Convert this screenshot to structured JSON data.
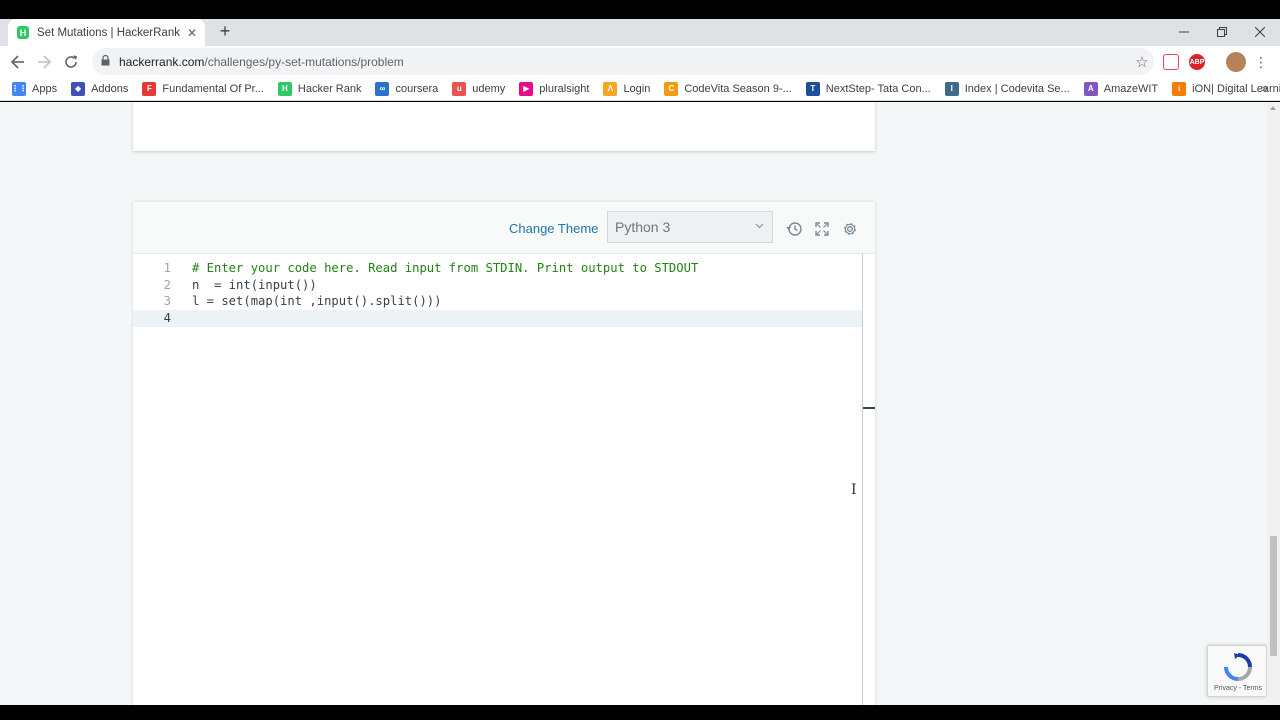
{
  "browser": {
    "tab": {
      "title": "Set Mutations | HackerRank",
      "favicon_letter": "H"
    },
    "url": {
      "host": "hackerrank.com",
      "path": "/challenges/py-set-mutations/problem"
    },
    "extensions": [
      {
        "name": "pocket-extension",
        "label": ""
      },
      {
        "name": "adblock-extension",
        "label": "ABP"
      }
    ]
  },
  "bookmarks": [
    {
      "icon": "apps-grid-icon",
      "label": "Apps",
      "color": "#4285f4"
    },
    {
      "icon": "addons-icon",
      "label": "Addons",
      "color": "#3f51b5"
    },
    {
      "icon": "fundamental-icon",
      "label": "Fundamental Of Pr...",
      "color": "#e53935"
    },
    {
      "icon": "hackerrank-icon",
      "label": "Hacker Rank",
      "color": "#2ec866"
    },
    {
      "icon": "coursera-icon",
      "label": "coursera",
      "color": "#2a73cc"
    },
    {
      "icon": "udemy-icon",
      "label": "udemy",
      "color": "#ec5252"
    },
    {
      "icon": "pluralsight-icon",
      "label": "pluralsight",
      "color": "#e80a89"
    },
    {
      "icon": "login-icon",
      "label": "Login",
      "color": "#f5a623"
    },
    {
      "icon": "codevita-icon",
      "label": "CodeVita Season 9-...",
      "color": "#f39c12"
    },
    {
      "icon": "tata-icon",
      "label": "NextStep- Tata Con...",
      "color": "#1f4e99"
    },
    {
      "icon": "index-icon",
      "label": "Index | Codevita Se...",
      "color": "#3f6b8a"
    },
    {
      "icon": "amazewit-icon",
      "label": "AmazeWIT",
      "color": "#7e57c2"
    },
    {
      "icon": "ion-icon",
      "label": "iON| Digital Learning",
      "color": "#f57c00"
    }
  ],
  "editor": {
    "change_theme_label": "Change Theme",
    "language": "Python 3",
    "lines": [
      {
        "num": "1",
        "text": "# Enter your code here. Read input from STDIN. Print output to STDOUT",
        "kind": "comment"
      },
      {
        "num": "2",
        "text": "n  = int(input())",
        "kind": "code"
      },
      {
        "num": "3",
        "text": "l = set(map(int ,input().split()))",
        "kind": "code"
      },
      {
        "num": "4",
        "text": "",
        "kind": "code"
      }
    ],
    "active_line": "4"
  },
  "recaptcha": {
    "footer": "Privacy - Terms"
  },
  "colors": {
    "accent_link": "#1f76a6",
    "comment": "#238214",
    "hackerrank_green": "#2ec866",
    "page_bg": "#f3f7f7"
  }
}
